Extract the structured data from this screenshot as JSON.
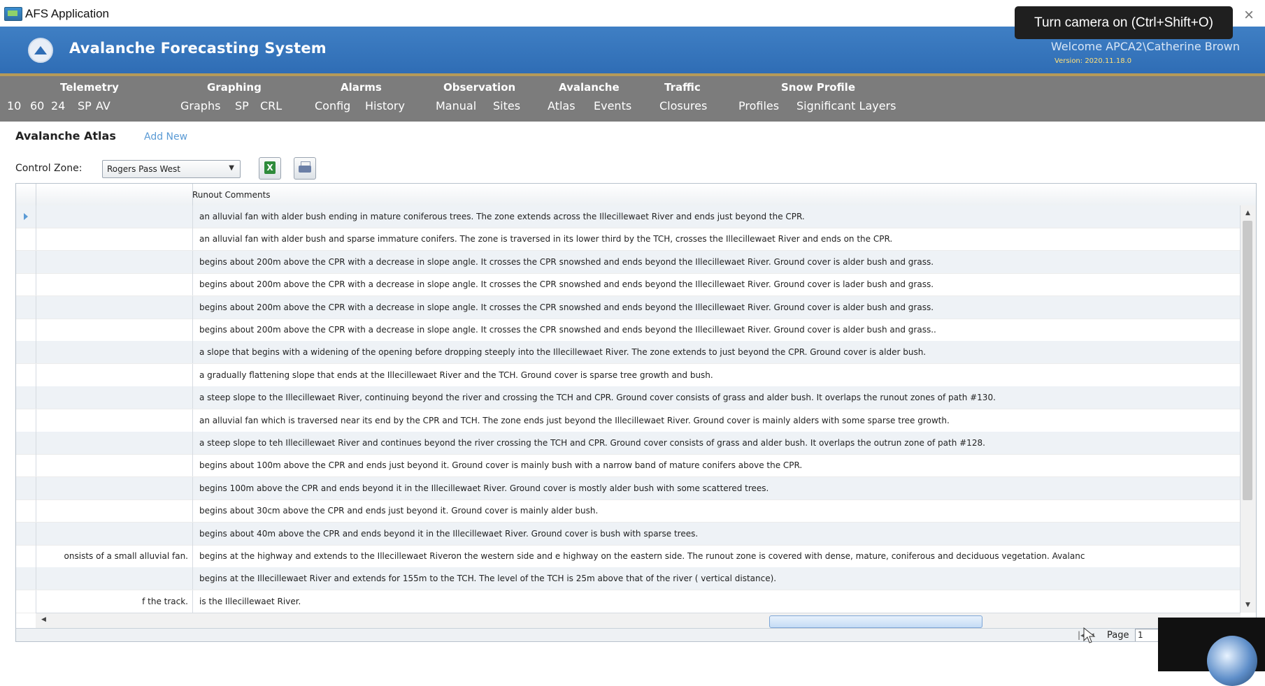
{
  "window": {
    "title": "AFS Application"
  },
  "tooltip": {
    "text": "Turn camera on (Ctrl+Shift+O)"
  },
  "header": {
    "system_title": "Avalanche Forecasting System",
    "welcome": "Welcome APCA2\\Catherine Brown",
    "version": "Version: 2020.11.18.0"
  },
  "menu": [
    {
      "title": "Telemetry",
      "items": [
        "10",
        "60",
        "24",
        "SP",
        "AV"
      ]
    },
    {
      "title": "Graphing",
      "items": [
        "Graphs",
        "SP",
        "CRL"
      ]
    },
    {
      "title": "Alarms",
      "items": [
        "Config",
        "History"
      ]
    },
    {
      "title": "Observation",
      "items": [
        "Manual",
        "Sites"
      ]
    },
    {
      "title": "Avalanche",
      "items": [
        "Atlas",
        "Events"
      ]
    },
    {
      "title": "Traffic",
      "items": [
        "Closures"
      ]
    },
    {
      "title": "Snow Profile",
      "items": [
        "Profiles",
        "Significant Layers"
      ]
    }
  ],
  "page": {
    "title": "Avalanche Atlas",
    "add_new": "Add New"
  },
  "filter": {
    "control_zone_label": "Control Zone:",
    "control_zone_value": "Rogers Pass West"
  },
  "toolbar": {
    "excel_icon": "excel-export-icon",
    "print_icon": "print-icon"
  },
  "grid": {
    "columns": [
      "",
      "Runout Comments"
    ],
    "rows": [
      {
        "c1": "",
        "c2": "an alluvial fan with alder bush ending in mature coniferous trees. The zone extends across the Illecillewaet River and ends just beyond the CPR."
      },
      {
        "c1": "",
        "c2": "an alluvial fan with alder bush and sparse immature conifers. The zone is traversed in its  lower third by the TCH, crosses the Illecillewaet River and ends on the CPR."
      },
      {
        "c1": "",
        "c2": "begins about 200m above the CPR with a decrease in slope angle. It crosses the CPR snowshed and ends beyond the Illecillewaet River. Ground cover is alder bush and grass."
      },
      {
        "c1": "",
        "c2": "begins about 200m above the CPR with a decrease in slope angle. It crosses the CPR snowshed and ends beyond the Illecillewaet River. Ground cover is lader bush and grass."
      },
      {
        "c1": "",
        "c2": "begins about 200m above the CPR with a decrease in slope angle. It crosses the CPR snowshed and ends beyond the Illecillewaet River. Ground cover is alder bush and grass."
      },
      {
        "c1": "",
        "c2": "begins about 200m above the CPR with a decrease in slope angle. It crosses the CPR snowshed and ends beyond the Illecillewaet River. Ground cover is alder bush and grass.."
      },
      {
        "c1": "",
        "c2": "a slope that begins with a widening of the opening before dropping steeply into the Illecillewaet River. The zone extends to just beyond the CPR. Ground cover is alder bush."
      },
      {
        "c1": "",
        "c2": "a gradually flattening slope that ends at the Illecillewaet River and the TCH. Ground cover is sparse tree growth and bush."
      },
      {
        "c1": "",
        "c2": "a steep slope to the Illecillewaet River, continuing beyond the river and crossing the TCH and CPR. Ground cover consists of grass and alder bush. It overlaps the runout zones of path #130."
      },
      {
        "c1": "",
        "c2": "an alluvial fan which is traversed near its end by the CPR and TCH. The zone ends just beyond the Illecillewaet River. Ground cover is mainly alders with some sparse tree growth."
      },
      {
        "c1": "",
        "c2": "a steep slope to teh Illecillewaet River and continues beyond the river crossing the TCH and CPR. Ground cover consists of grass and alder bush. It overlaps the outrun zone of path #128."
      },
      {
        "c1": "",
        "c2": "begins about 100m above the CPR and ends just beyond it. Ground cover is mainly bush with a narrow band of mature conifers above the CPR."
      },
      {
        "c1": "",
        "c2": "begins 100m above the CPR and ends beyond it in the Illecillewaet River. Ground cover is mostly alder bush with some scattered trees."
      },
      {
        "c1": "",
        "c2": "begins about 30cm above the CPR and ends just beyond it. Ground cover is mainly alder bush."
      },
      {
        "c1": "",
        "c2": "begins about 40m above the CPR and ends beyond it in the Illecillewaet River. Ground cover is bush with sparse trees."
      },
      {
        "c1": "onsists of a small alluvial fan.",
        "c2": "begins at the highway and extends to the Illecillewaet Riveron the western side and e highway on the eastern side. The runout zone is covered with dense, mature, coniferous and deciduous vegetation. Avalanc"
      },
      {
        "c1": "",
        "c2": "begins at the Illecillewaet River and extends for 155m to the TCH. The level of the TCH is 25m above that of the river ( vertical distance)."
      },
      {
        "c1": "f the track.",
        "c2": "is the Illecillewaet River."
      }
    ]
  },
  "pager": {
    "page_label": "Page",
    "page_value": "1"
  }
}
